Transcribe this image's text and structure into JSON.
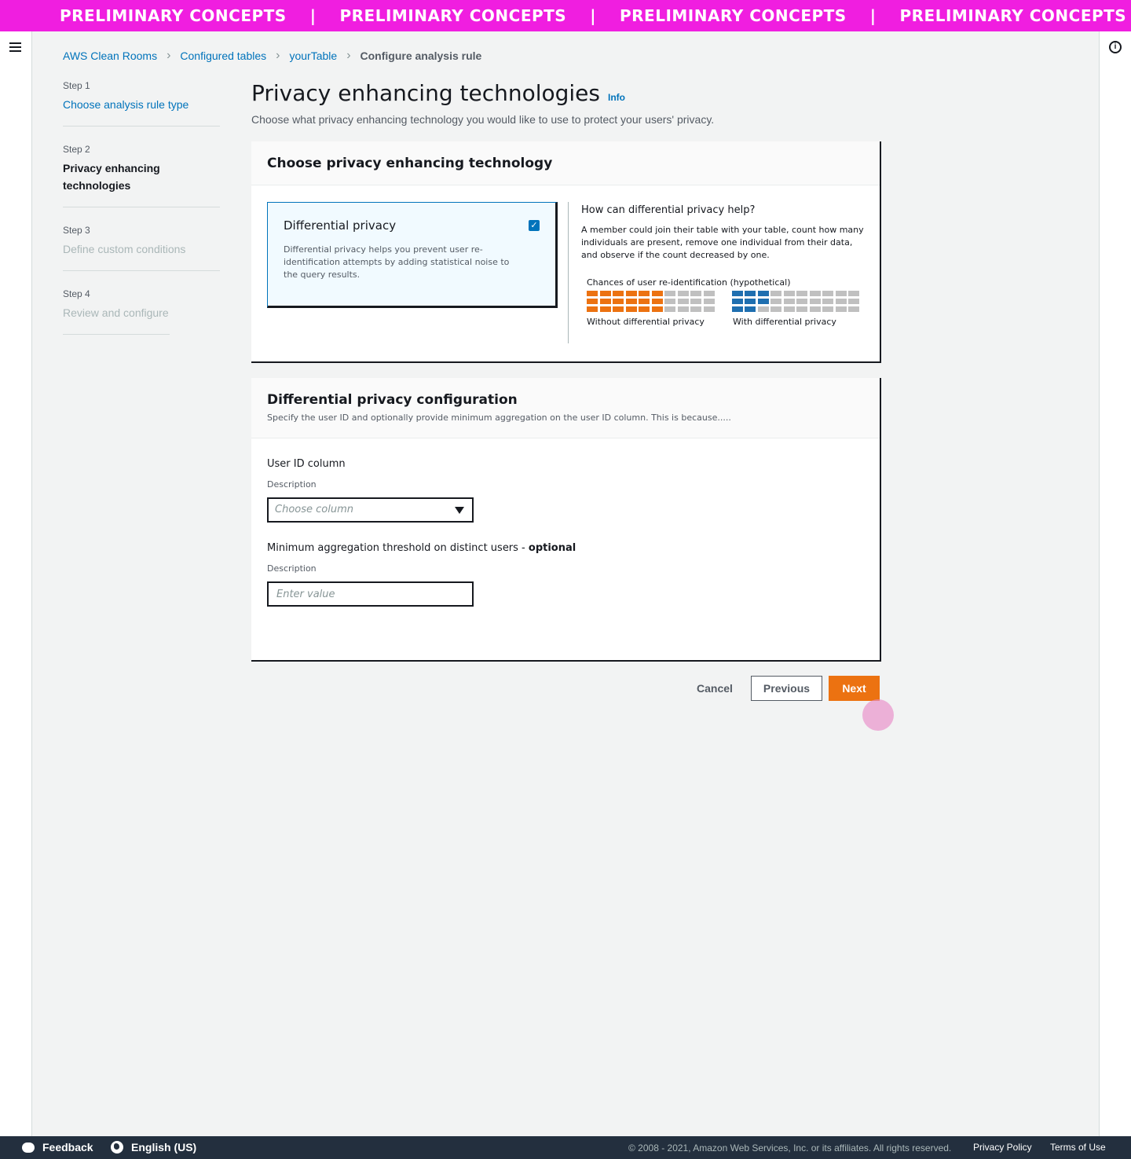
{
  "banner": {
    "text": "PRELIMINARY CONCEPTS",
    "separator": "|",
    "color": "#f01ee0"
  },
  "breadcrumb": {
    "items": [
      "AWS Clean Rooms",
      "Configured tables",
      "yourTable"
    ],
    "current": "Configure analysis rule"
  },
  "steps": [
    {
      "num": "Step 1",
      "label": "Choose analysis rule type",
      "state": "link"
    },
    {
      "num": "Step 2",
      "label": "Privacy enhancing technologies",
      "state": "active"
    },
    {
      "num": "Step 3",
      "label": "Define custom conditions",
      "state": "disabled"
    },
    {
      "num": "Step 4",
      "label": "Review and configure",
      "state": "disabled"
    }
  ],
  "page": {
    "title": "Privacy enhancing technologies",
    "info": "Info",
    "subtitle": "Choose what privacy enhancing technology you would like to use to protect your users' privacy."
  },
  "panel1": {
    "title": "Choose privacy enhancing technology",
    "tile": {
      "title": "Differential privacy",
      "description": "Differential privacy helps you prevent user re-identification attempts by adding statistical noise to the query results.",
      "checked": true
    },
    "help": {
      "question": "How can differential privacy help?",
      "answer": "A member could join their table with your table, count how many individuals are present, remove one individual from their data, and observe if the count decreased by one.",
      "caption": "Chances of user re-identification (hypothetical)",
      "without_label": "Without differential privacy",
      "with_label": "With differential privacy",
      "without_highlighted_per_row": [
        6,
        6,
        6
      ],
      "with_highlighted_per_row": [
        3,
        3,
        2
      ],
      "cells_per_row": 10,
      "colors": {
        "without": "#ec7211",
        "with": "#1f6fb0",
        "neutral": "#c0c0c0"
      }
    }
  },
  "panel2": {
    "title": "Differential privacy configuration",
    "description": "Specify the user ID and optionally provide minimum aggregation on the user ID column. This is because.....",
    "user_id": {
      "label": "User ID column",
      "description": "Description",
      "placeholder": "Choose column"
    },
    "threshold": {
      "label": "Minimum aggregation threshold on distinct users - ",
      "optional": "optional",
      "description": "Description",
      "placeholder": "Enter value"
    }
  },
  "actions": {
    "cancel": "Cancel",
    "previous": "Previous",
    "next": "Next",
    "accent": "#ec7211"
  },
  "footer": {
    "feedback": "Feedback",
    "language": "English (US)",
    "copyright": "© 2008 - 2021, Amazon Web Services, Inc. or its affiliates. All rights reserved.",
    "privacy": "Privacy Policy",
    "terms": "Terms of Use"
  }
}
